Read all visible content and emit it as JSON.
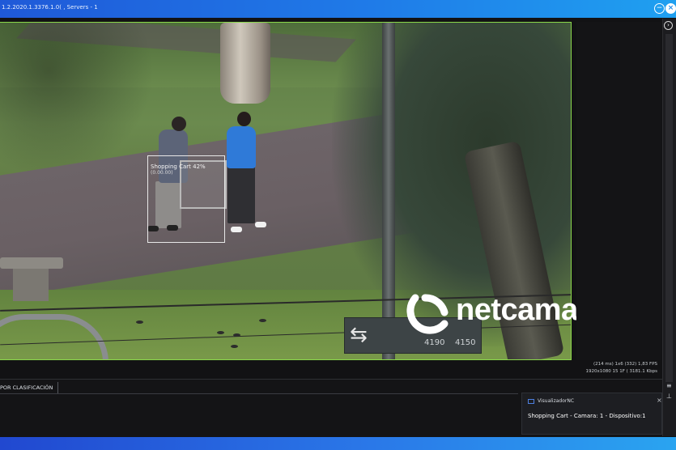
{
  "window": {
    "title": "1.2.2020.1.3376.1.0( , Servers - 1",
    "minimize_glyph": "−",
    "close_glyph": "×",
    "accent_colors": [
      "#1f59d8",
      "#1fa0f0"
    ]
  },
  "video": {
    "detection": {
      "label": "Shopping Cart 42%",
      "sub_label": "(0.00.00)"
    },
    "sign": {
      "arrow": "⇆",
      "numbers": [
        "4190",
        "4150"
      ]
    },
    "watermark": {
      "brand": "netcamara",
      "icon": "netcamara-logo-icon"
    }
  },
  "stats": {
    "line1": "(214 ms)  1x6 (332) 1,83 FPS",
    "line2": "1920x1080   15 1F (   3181.1 Kbps"
  },
  "bottom": {
    "tab_label": "POR CLASIFICACIÓN"
  },
  "notification": {
    "app_name": "VisualizadorNC",
    "message": "Shopping Cart - Camara: 1 - Dispositivo:1",
    "close_glyph": "×"
  },
  "scrollbar": {
    "top_button_glyph": "›",
    "icon1": "≡",
    "icon2": "⊥"
  }
}
